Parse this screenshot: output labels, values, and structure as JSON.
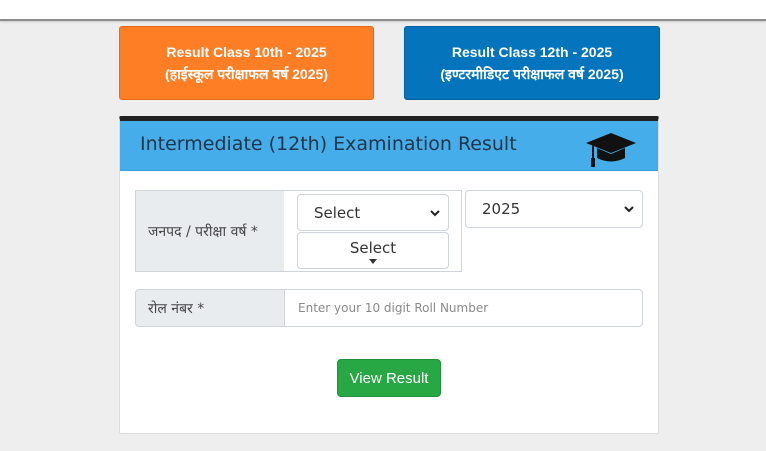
{
  "buttons": {
    "class10": {
      "line1": "Result Class 10th - 2025",
      "line2": "(हाईस्कूल परीक्षाफल वर्ष 2025)",
      "color": "#fd7e24"
    },
    "class12": {
      "line1": "Result Class 12th - 2025",
      "line2": "(इण्टरमीडिएट परीक्षाफल वर्ष 2025)",
      "color": "#0474bc"
    }
  },
  "card": {
    "title": "Intermediate (12th) Examination Result",
    "header_color": "#45aeea"
  },
  "form": {
    "district_year_label": "जनपद / परीक्षा वर्ष *",
    "district_select_value": "Select",
    "second_select_value": "Select",
    "year_select_value": "2025",
    "roll_label": "रोल नंबर *",
    "roll_placeholder": "Enter your 10 digit Roll Number",
    "submit_label": "View Result",
    "submit_color": "#28a745"
  },
  "icons": {
    "header_icon": "graduation-cap-icon",
    "select_arrow": "chevron-down-icon"
  }
}
